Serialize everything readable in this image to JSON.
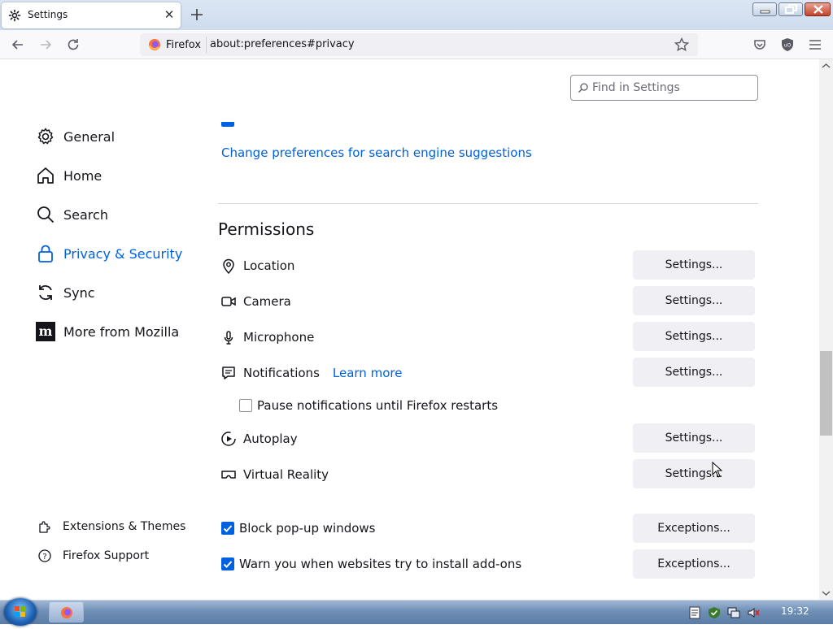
{
  "browser": {
    "tab_title": "Settings",
    "identity_label": "Firefox",
    "url": "about:preferences#privacy"
  },
  "search": {
    "placeholder": "Find in Settings"
  },
  "sidebar": {
    "items": [
      {
        "label": "General",
        "icon": "gear-icon"
      },
      {
        "label": "Home",
        "icon": "home-icon"
      },
      {
        "label": "Search",
        "icon": "search-icon"
      },
      {
        "label": "Privacy & Security",
        "icon": "lock-icon",
        "selected": true
      },
      {
        "label": "Sync",
        "icon": "sync-icon"
      },
      {
        "label": "More from Mozilla",
        "icon": "mozilla-icon"
      }
    ],
    "footer": [
      {
        "label": "Extensions & Themes",
        "icon": "puzzle-icon"
      },
      {
        "label": "Firefox Support",
        "icon": "help-icon"
      }
    ]
  },
  "main": {
    "search_suggestions_link": "Change preferences for search engine suggestions",
    "permissions_heading": "Permissions",
    "permissions": [
      {
        "label": "Location",
        "icon": "location-icon",
        "button": "Settings..."
      },
      {
        "label": "Camera",
        "icon": "camera-icon",
        "button": "Settings..."
      },
      {
        "label": "Microphone",
        "icon": "microphone-icon",
        "button": "Settings..."
      },
      {
        "label": "Notifications",
        "icon": "notifications-icon",
        "button": "Settings...",
        "link": "Learn more"
      },
      {
        "label": "Autoplay",
        "icon": "autoplay-icon",
        "button": "Settings..."
      },
      {
        "label": "Virtual Reality",
        "icon": "vr-icon",
        "button": "Settings..."
      }
    ],
    "pause_notifications": {
      "label": "Pause notifications until Firefox restarts",
      "checked": false
    },
    "block_popups": {
      "label": "Block pop-up windows",
      "checked": true,
      "button": "Exceptions..."
    },
    "warn_addons": {
      "label": "Warn you when websites try to install add-ons",
      "checked": true,
      "button": "Exceptions..."
    }
  },
  "taskbar": {
    "clock": "19:32"
  },
  "colors": {
    "accent": "#0061e0",
    "button_bg": "#f0f0f4"
  }
}
